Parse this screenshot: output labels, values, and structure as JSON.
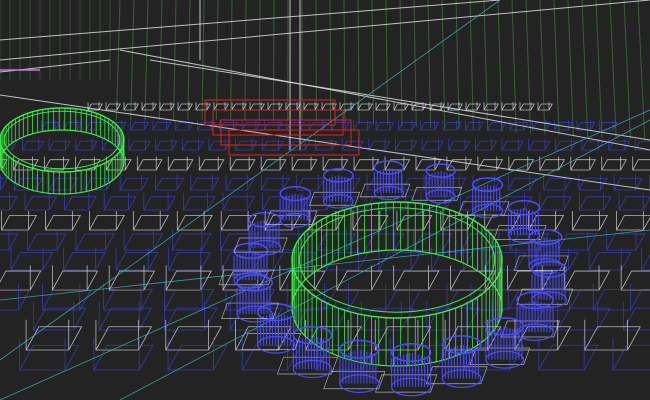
{
  "scene": {
    "view": "3d-wireframe-viewport",
    "colors": {
      "background": "#232323",
      "table": "#3fe84a",
      "chair": "#4a4cff",
      "seat_grid": "#3b46d8",
      "structure": "#e8e8f0",
      "wall_lines": "#3f7a3a",
      "highlight_box": "#e02020",
      "guide_lines": "#3fb8c8",
      "accent_magenta": "#d070e0"
    },
    "round_tables": 2,
    "chairs_around_main_table": 18
  }
}
